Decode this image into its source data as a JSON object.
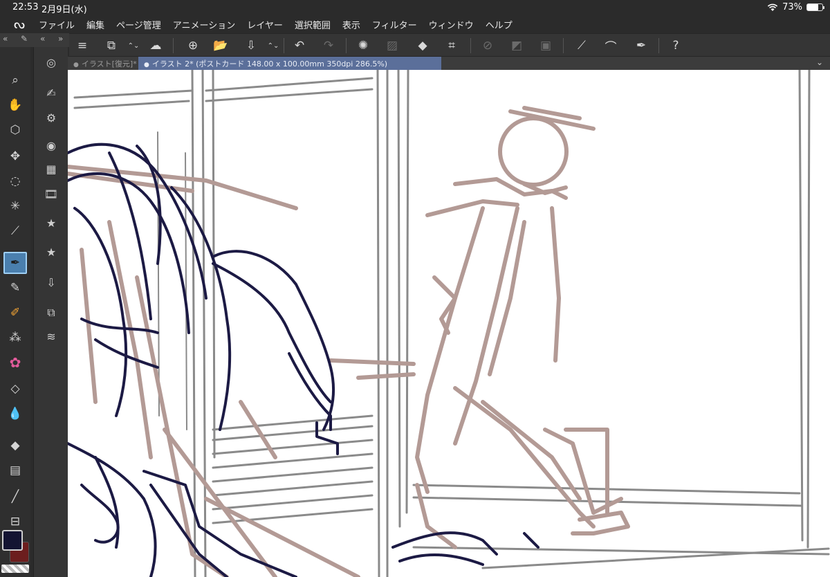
{
  "status_bar": {
    "time": "22:53",
    "date": "2月9日(水)",
    "battery": "73%",
    "battery_level": 0.73
  },
  "menu": {
    "logo": "ᔓ",
    "items": [
      "ファイル",
      "編集",
      "ページ管理",
      "アニメーション",
      "レイヤー",
      "選択範囲",
      "表示",
      "フィルター",
      "ウィンドウ",
      "ヘルプ"
    ]
  },
  "panel_header": {
    "collapse_left": "«",
    "collapse_right": "»",
    "menu_glyph": "≡",
    "brush_glyph": "✎"
  },
  "tabs": [
    {
      "label": "イラスト[復元]*"
    },
    {
      "label": "イラスト 2* (ポストカード 148.00 x 100.00mm 350dpi 286.5%)"
    }
  ],
  "tab_dot": "●",
  "tab_menu_glyph": "⌄",
  "commands": {
    "menu": "≡",
    "edit": "⧉",
    "updown": "⌃⌄",
    "cloud": "☁",
    "new": "⊕",
    "open": "📂",
    "save": "⇩",
    "undo": "↶",
    "redo": "↷",
    "transform": "✺",
    "clear": "▨",
    "fill": "◆",
    "crop": "⌗",
    "sel_none": "⊘",
    "sel_invert": "◩",
    "sel_show": "▣",
    "ruler": "⟋",
    "brushline": "⌒",
    "pen": "✒",
    "help": "?"
  },
  "tools": [
    {
      "name": "zoom-icon",
      "glyph": "⌕"
    },
    {
      "name": "hand-icon",
      "glyph": "✋"
    },
    {
      "name": "object-icon",
      "glyph": "⬡"
    },
    {
      "name": "move-icon",
      "glyph": "✥"
    },
    {
      "name": "lasso-icon",
      "glyph": "◌"
    },
    {
      "name": "auto-select-icon",
      "glyph": "✳"
    },
    {
      "name": "eyedropper-icon",
      "glyph": "⟋"
    },
    {
      "name": "pen-icon",
      "glyph": "✒"
    },
    {
      "name": "pencil-icon",
      "glyph": "✎"
    },
    {
      "name": "brush-icon",
      "glyph": "✐"
    },
    {
      "name": "airbrush-icon",
      "glyph": "⁂"
    },
    {
      "name": "decoration-icon",
      "glyph": "✿"
    },
    {
      "name": "eraser-icon",
      "glyph": "◇"
    },
    {
      "name": "blend-icon",
      "glyph": "💧"
    },
    {
      "name": "fill-icon",
      "glyph": "◆"
    },
    {
      "name": "gradient-icon",
      "glyph": "▤"
    },
    {
      "name": "figure-icon",
      "glyph": "╱"
    },
    {
      "name": "frame-icon",
      "glyph": "⊟"
    }
  ],
  "subtools": [
    {
      "name": "navigator-icon",
      "glyph": "◎"
    },
    {
      "name": "subtool-detail-icon",
      "glyph": "✍"
    },
    {
      "name": "tool-property-icon",
      "glyph": "⚙"
    },
    {
      "name": "color-circle-icon",
      "glyph": "◉"
    },
    {
      "name": "color-set-icon",
      "glyph": "▦"
    },
    {
      "name": "timeline-icon",
      "glyph": "🎞"
    },
    {
      "name": "material-icon",
      "glyph": "★"
    },
    {
      "name": "material-2-icon",
      "glyph": "★"
    },
    {
      "name": "download-material-icon",
      "glyph": "⇩"
    },
    {
      "name": "layer-property-icon",
      "glyph": "⧉"
    },
    {
      "name": "layer-icon",
      "glyph": "≋"
    }
  ],
  "colors": {
    "main": "#141432",
    "sub": "#6c1e1e",
    "accent": "#5b6f9a",
    "sketch_brown": "#b39a95",
    "sketch_navy": "#1c1a44"
  }
}
